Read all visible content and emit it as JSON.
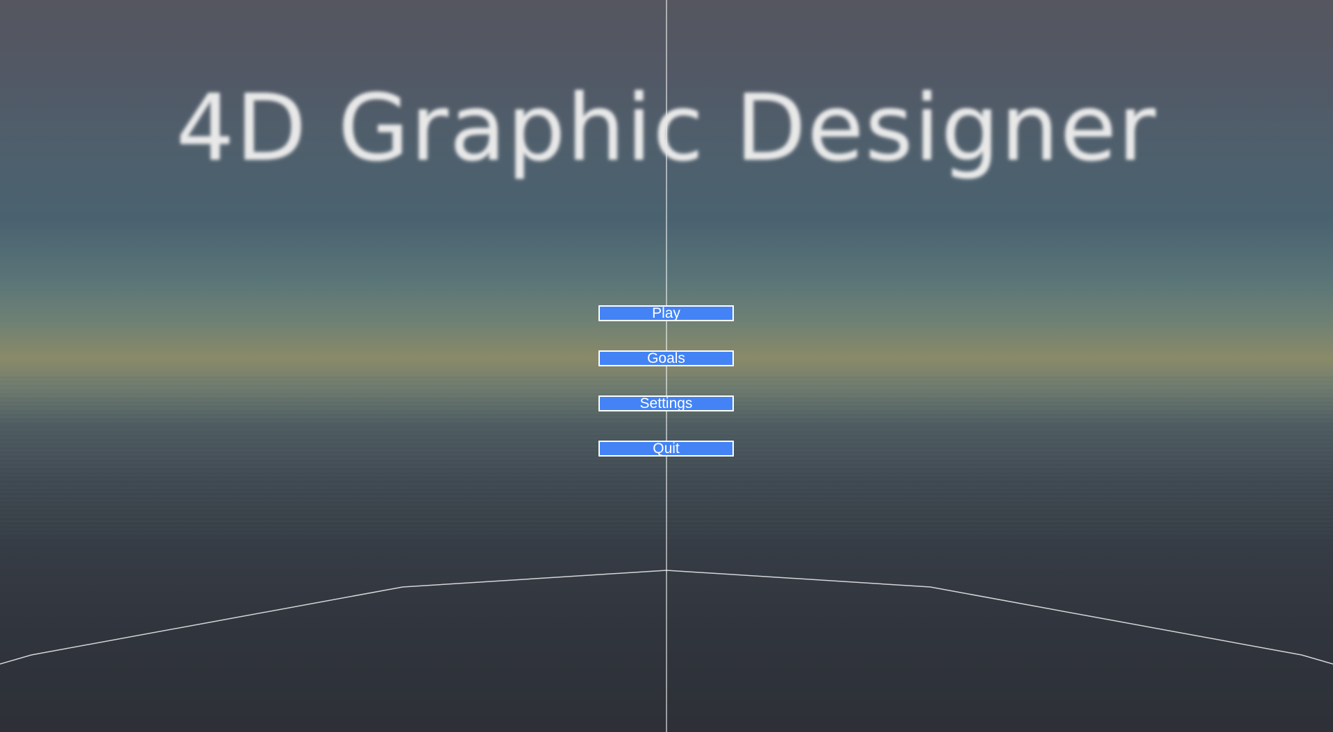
{
  "title": "4D Graphic Designer",
  "menu": {
    "play_label": "Play",
    "goals_label": "Goals",
    "settings_label": "Settings",
    "quit_label": "Quit"
  },
  "colors": {
    "button_fill": "#4383f5",
    "button_border": "#ffffff",
    "title_text": "#e8e8e8",
    "grid_line": "#ffffff"
  }
}
